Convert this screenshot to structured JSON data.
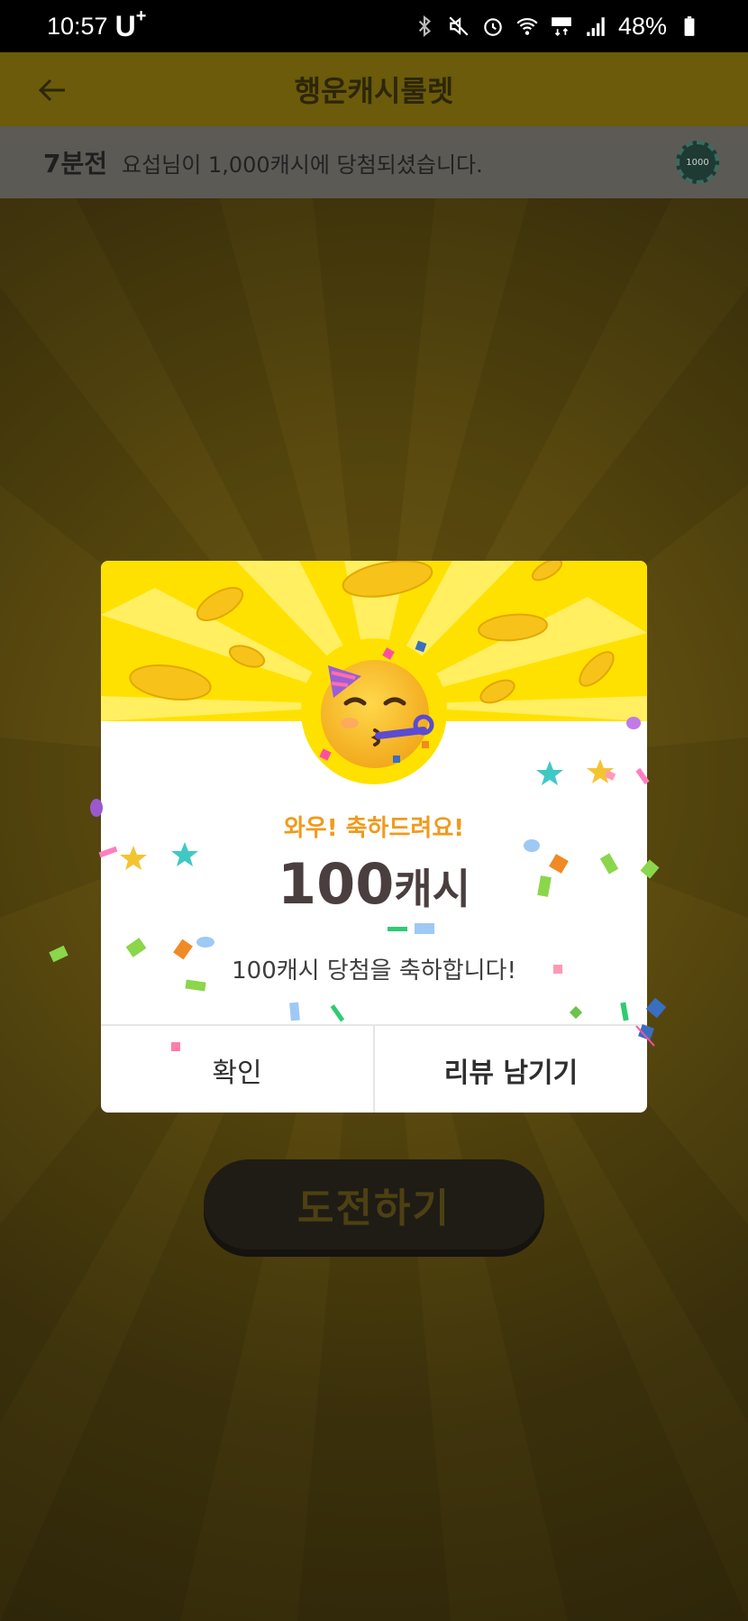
{
  "status_bar": {
    "time": "10:57",
    "carrier": "U",
    "carrier_sup": "+",
    "battery": "48%",
    "icons": [
      "bluetooth-icon",
      "mute-icon",
      "alarm-icon",
      "wifi-icon",
      "lte-icon",
      "signal-icon",
      "battery-icon"
    ]
  },
  "app_bar": {
    "title": "행운캐시룰렛",
    "back_icon": "arrow-left-icon"
  },
  "ticker": {
    "time_ago": "7분전",
    "message": "요섭님이 1,000캐시에 당첨되셨습니다.",
    "chip_label": "1000"
  },
  "modal": {
    "subtitle": "와우! 축하드려요!",
    "amount_number": "100",
    "amount_unit": "캐시",
    "description": "100캐시 당첨을 축하합니다!",
    "confirm_label": "확인",
    "review_label": "리뷰 남기기",
    "emoji": "partying-face-icon"
  },
  "challenge_button": {
    "label": "도전하기"
  },
  "colors": {
    "accent_yellow": "#ffe100",
    "subtitle_orange": "#f19a1c",
    "amount_text": "#4a3e3e"
  }
}
